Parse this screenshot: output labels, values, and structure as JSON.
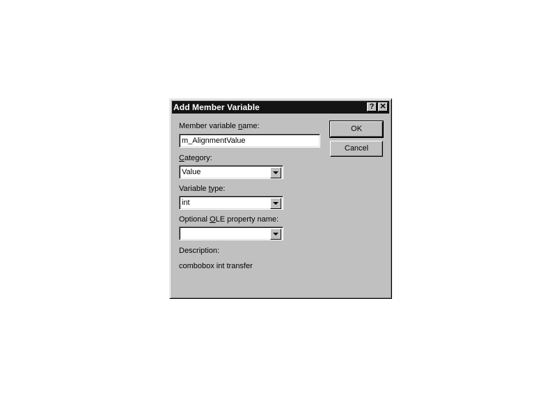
{
  "dialog": {
    "title": "Add Member Variable",
    "help_glyph": "?",
    "close_glyph": "✕"
  },
  "fields": {
    "member_name": {
      "label_pre": "Member variable ",
      "label_accel": "n",
      "label_post": "ame:",
      "value": "m_AlignmentValue"
    },
    "category": {
      "label_pre": "",
      "label_accel": "C",
      "label_post": "ategory:",
      "value": "Value"
    },
    "variable_type": {
      "label_pre": "Variable ",
      "label_accel": "t",
      "label_post": "ype:",
      "value": "int"
    },
    "ole_property": {
      "label_pre": "Optional ",
      "label_accel": "O",
      "label_post": "LE property name:",
      "value": ""
    },
    "description": {
      "label": "Description:",
      "value": "combobox int transfer"
    }
  },
  "buttons": {
    "ok": "OK",
    "cancel": "Cancel"
  },
  "colors": {
    "dialog_face": "#c0c0c0",
    "titlebar": "#141414"
  },
  "icons": {
    "help": "help-icon",
    "close": "close-icon",
    "dropdown": "chevron-down-icon"
  }
}
